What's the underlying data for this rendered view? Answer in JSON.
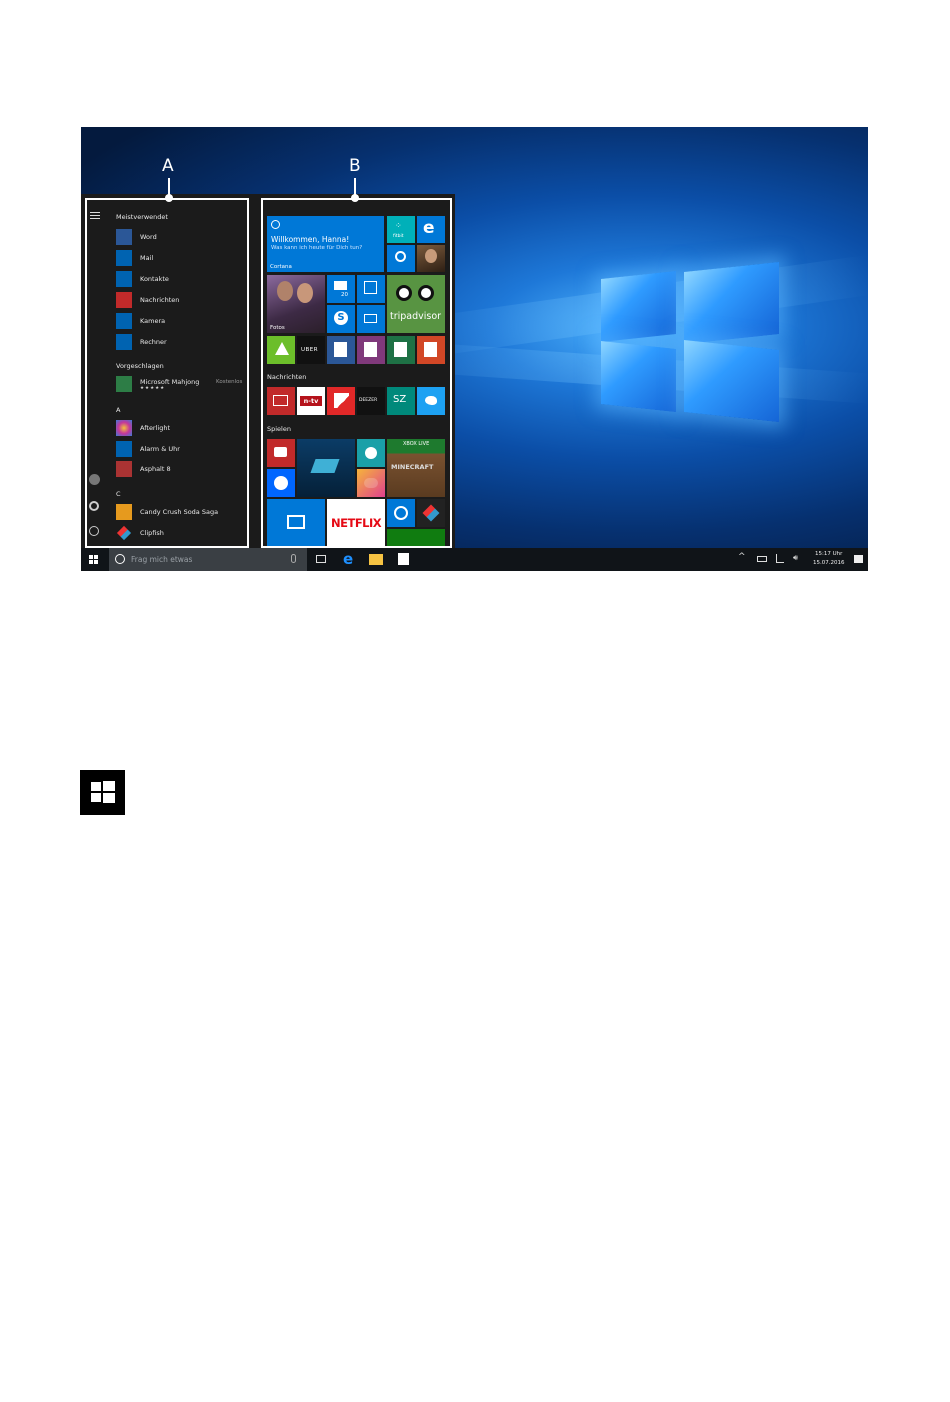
{
  "callouts": {
    "a": "A",
    "b": "B"
  },
  "start_menu": {
    "most_used_header": "Meistverwendet",
    "most_used": [
      {
        "label": "Word",
        "color": "#2b5797"
      },
      {
        "label": "Mail",
        "color": "#0063b1"
      },
      {
        "label": "Kontakte",
        "color": "#0063b1"
      },
      {
        "label": "Nachrichten",
        "color": "#c12a2a"
      },
      {
        "label": "Kamera",
        "color": "#0063b1"
      },
      {
        "label": "Rechner",
        "color": "#0063b1"
      }
    ],
    "suggested_header": "Vorgeschlagen",
    "suggested": {
      "label": "Microsoft Mahjong",
      "tag": "Kostenlos",
      "stars": "★★★★★"
    },
    "section_a": "A",
    "a_apps": [
      "Afterlight",
      "Alarm & Uhr",
      "Asphalt 8"
    ],
    "section_c": "C",
    "c_apps": [
      "Candy Crush Soda Saga",
      "Clipfish"
    ]
  },
  "tiles": {
    "cortana_greeting": "Willkommen, Hanna!",
    "cortana_sub": "Was kann ich heute für Dich tun?",
    "cortana_label": "Cortana",
    "fitbit_label": "fitbit",
    "photos_label": "Fotos",
    "mail_count": "20",
    "tripadvisor_label": "tripadvisor",
    "uber_label": "UBER",
    "news_header": "Nachrichten",
    "ntv_label": "n-tv",
    "deezer_label": "DEEZER",
    "sz_label": "SZ",
    "games_header": "Spielen",
    "xbox_label": "XBOX LIVE",
    "minecraft_label": "MINECRAFT",
    "netflix_label": "NETFLIX"
  },
  "taskbar": {
    "search_placeholder": "Frag mich etwas",
    "time": "15:17 Uhr",
    "date": "15.07.2016"
  }
}
